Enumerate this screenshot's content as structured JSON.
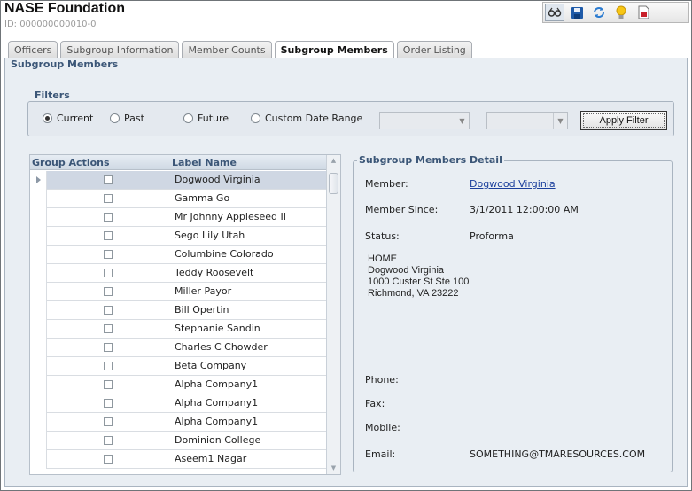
{
  "header": {
    "title": "NASE Foundation",
    "id_text": "ID: 000000000010-0"
  },
  "toolbar": {
    "icons": [
      "glasses-icon",
      "save-icon",
      "refresh-icon",
      "lightbulb-icon",
      "report-icon"
    ]
  },
  "tabs": [
    {
      "label": "Officers",
      "active": false
    },
    {
      "label": "Subgroup Information",
      "active": false
    },
    {
      "label": "Member Counts",
      "active": false
    },
    {
      "label": "Subgroup Members",
      "active": true
    },
    {
      "label": "Order Listing",
      "active": false
    }
  ],
  "panel": {
    "title": "Subgroup Members"
  },
  "filters": {
    "title": "Filters",
    "options": [
      {
        "label": "Current",
        "selected": true
      },
      {
        "label": "Past",
        "selected": false
      },
      {
        "label": "Future",
        "selected": false
      },
      {
        "label": "Custom Date Range",
        "selected": false
      }
    ],
    "apply_label": "Apply Filter"
  },
  "grid": {
    "columns": [
      "Group Actions",
      "Label Name"
    ],
    "rows": [
      "Dogwood Virginia",
      "Gamma Go",
      "Mr Johnny Appleseed II",
      "Sego Lily Utah",
      "Columbine Colorado",
      "Teddy Roosevelt",
      "Miller Payor",
      "Bill Opertin",
      "Stephanie Sandin",
      "Charles C Chowder",
      "Beta Company",
      "Alpha Company1",
      "Alpha Company1",
      "Alpha Company1",
      "Dominion College",
      "Aseem1 Nagar"
    ]
  },
  "detail": {
    "title": "Subgroup Members Detail",
    "member_label": "Member:",
    "member_value": "Dogwood Virginia",
    "since_label": "Member Since:",
    "since_value": "3/1/2011 12:00:00 AM",
    "status_label": "Status:",
    "status_value": "Proforma",
    "address": {
      "type": "HOME",
      "name": "Dogwood Virginia",
      "street": "1000 Custer St Ste 100",
      "city_line": "Richmond, VA 23222"
    },
    "phone_label": "Phone:",
    "fax_label": "Fax:",
    "mobile_label": "Mobile:",
    "email_label": "Email:",
    "email_value": "SOMETHING@TMARESOURCES.COM"
  }
}
